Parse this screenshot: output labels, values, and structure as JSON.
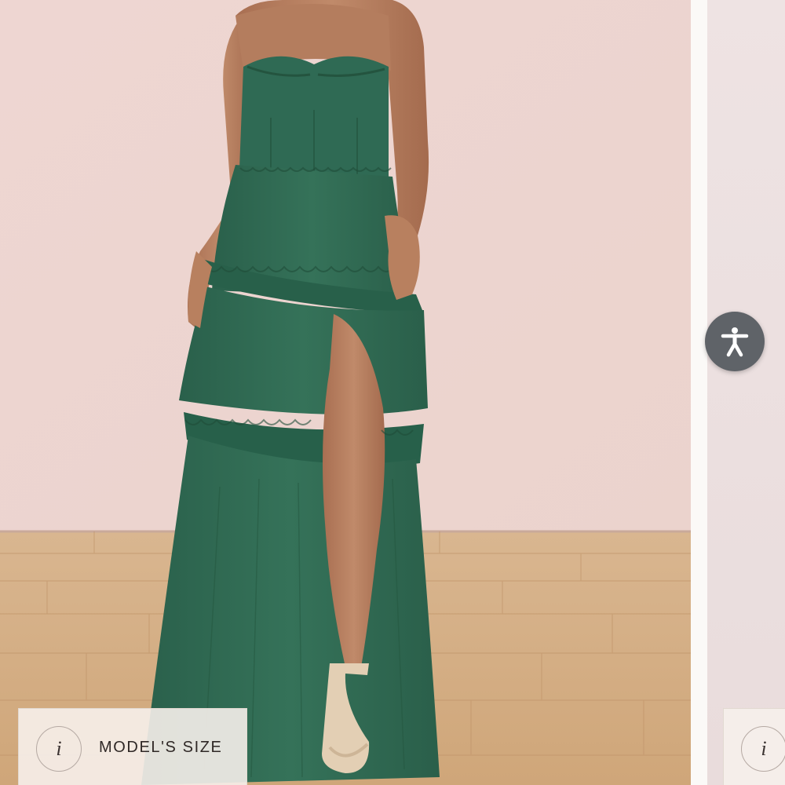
{
  "product_gallery": {
    "main_image": {
      "alt": "",
      "colors": {
        "wall": "#efd8d3",
        "floor": "#d4ad83",
        "dress": "#2f6a54",
        "skin": "#b07a5c"
      }
    },
    "size_chip": {
      "info_glyph": "i",
      "label": "MODEL'S SIZE"
    },
    "size_chip_next": {
      "info_glyph": "i"
    },
    "accessibility_button": {
      "icon": "accessibility-person-icon",
      "color": "#5f6368"
    }
  }
}
